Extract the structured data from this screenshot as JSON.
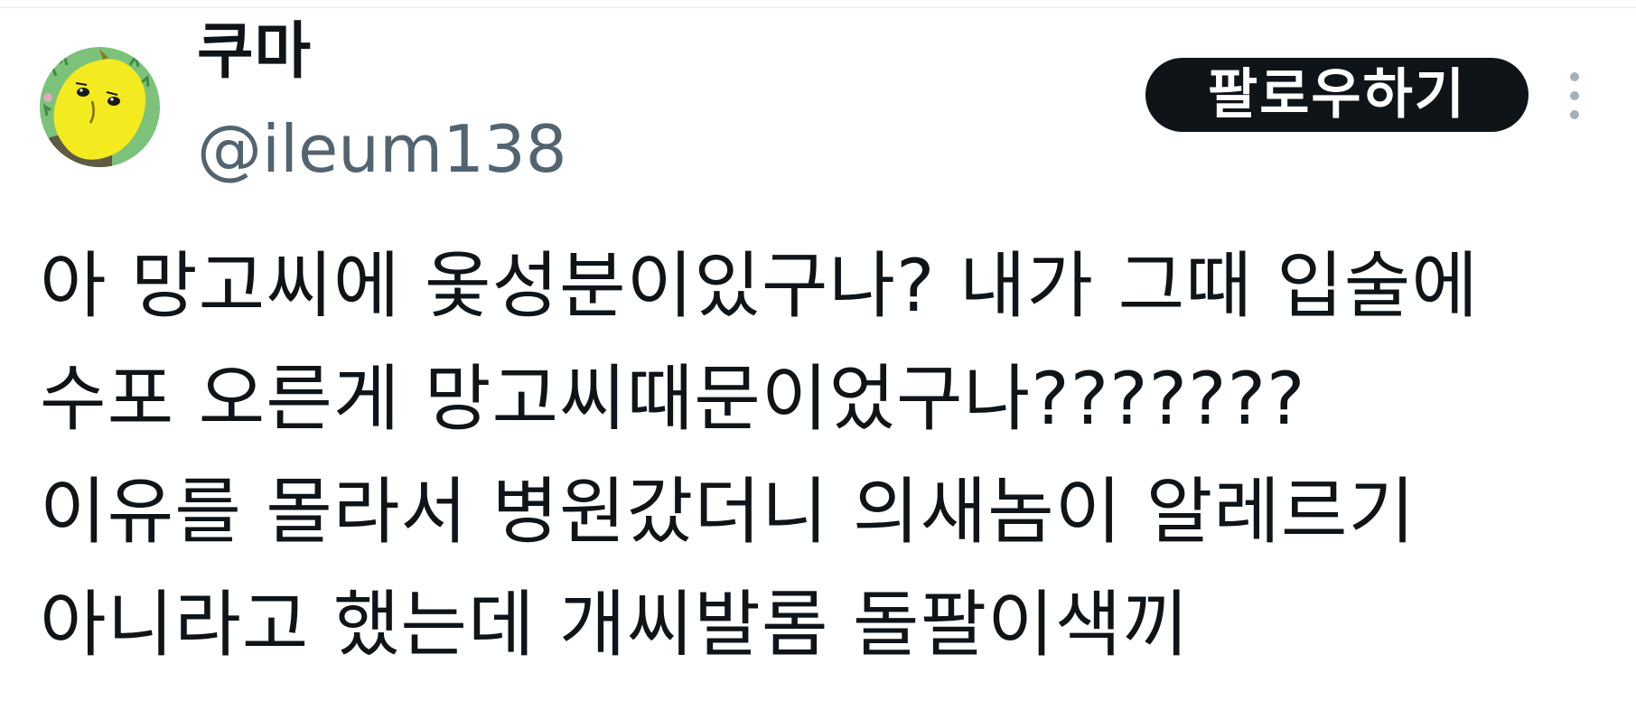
{
  "author": {
    "display_name": "쿠마",
    "handle": "@ileum138",
    "avatar": "yellow-lemon-character-avatar"
  },
  "actions": {
    "follow_label": "팔로우하기",
    "more_icon": "vertical-ellipsis-icon"
  },
  "tweet": {
    "lines": [
      "아 망고씨에 옻성분이있구나? 내가 그때 입술에",
      "수포 오른게 망고씨때문이었구나???????",
      "이유를 몰라서 병원갔더니 의새놈이 알레르기",
      "아니라고 했는데 개씨발롬 돌팔이색끼"
    ]
  },
  "colors": {
    "text_primary": "#0f1419",
    "text_secondary": "#536471",
    "button_bg": "#0f1419",
    "button_text": "#ffffff",
    "more_icon": "#a6b0b8"
  }
}
